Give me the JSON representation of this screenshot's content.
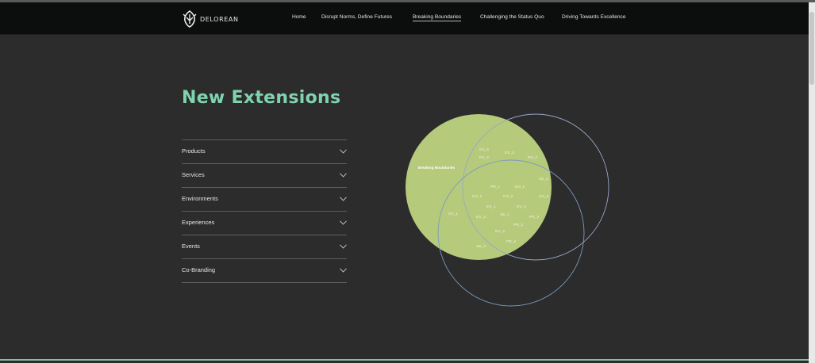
{
  "nav": {
    "logo_text": "DELOREAN",
    "links": [
      {
        "label": "Home",
        "active": false
      },
      {
        "label": "Disrupt Norms, Define Futures",
        "active": false
      },
      {
        "label": "Breaking Boundaries",
        "active": true
      },
      {
        "label": "Challenging the Status Quo",
        "active": false
      },
      {
        "label": "Driving Towards Excellence",
        "active": false
      }
    ]
  },
  "section": {
    "title": "New Extensions"
  },
  "accordion": {
    "items": [
      {
        "label": "Products"
      },
      {
        "label": "Services"
      },
      {
        "label": "Environments"
      },
      {
        "label": "Experiences"
      },
      {
        "label": "Events"
      },
      {
        "label": "Co-Branding"
      }
    ]
  },
  "venn": {
    "filled_circle_label": "Breaking Boundaries",
    "fill_color": "#b6ca7c",
    "outline_color_right": "#9aa6c9",
    "outline_color_bottom": "#7b9bc3",
    "labels": [
      "EX_5",
      "EX_2",
      "EX_3",
      "EN_2",
      "SE_2",
      "PR_1",
      "EN_1",
      "CO_1",
      "CO_2",
      "CO_3",
      "EX_1",
      "EV_2",
      "EX_1",
      "EV_3",
      "SE_1",
      "PR_3",
      "PR_2",
      "EV_4",
      "PR_4",
      "SE_3"
    ]
  },
  "colors": {
    "background": "#2b2c2b",
    "navbar": "#0c0d0d",
    "heading": "#7fd3ae"
  }
}
